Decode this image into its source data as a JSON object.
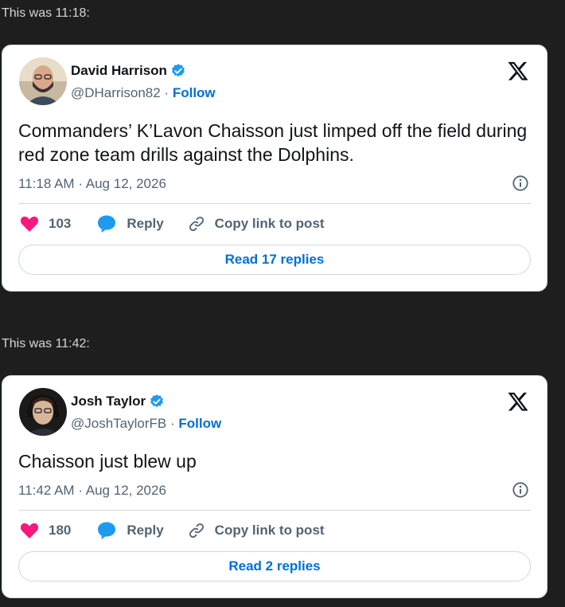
{
  "captions": [
    "This was 11:18:",
    "This was 11:42:"
  ],
  "colors": {
    "like": "#f91880",
    "link": "#006fd6",
    "verified": "#1d9bf0",
    "bg": "#1e1e1e"
  },
  "tweets": [
    {
      "name": "David Harrison",
      "handle": "@DHarrison82",
      "separator": "·",
      "follow": "Follow",
      "text": "Commanders’ K’Lavon Chaisson just limped off the field during red zone team drills against the Dolphins.",
      "time": "11:18 AM",
      "date": "Aug 12, 2026",
      "likes": "103",
      "reply": "Reply",
      "copy_link": "Copy link to post",
      "read_replies": "Read 17 replies",
      "avatar_icon": "bald-man-avatar"
    },
    {
      "name": "Josh Taylor",
      "handle": "@JoshTaylorFB",
      "separator": "·",
      "follow": "Follow",
      "text": "Chaisson just blew up",
      "time": "11:42 AM",
      "date": "Aug 12, 2026",
      "likes": "180",
      "reply": "Reply",
      "copy_link": "Copy link to post",
      "read_replies": "Read 2 replies",
      "avatar_icon": "man-headset-avatar"
    }
  ]
}
